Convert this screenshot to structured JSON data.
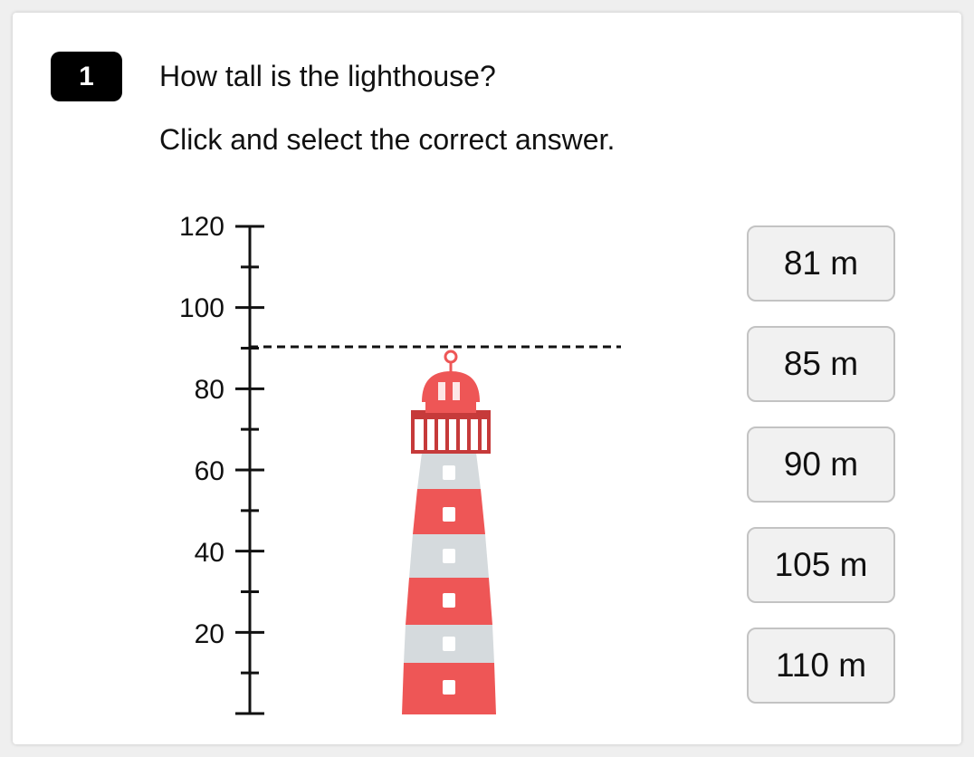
{
  "question": {
    "number": "1",
    "text": "How tall is the lighthouse?",
    "instruction": "Click and select the correct answer."
  },
  "scale": {
    "labels": [
      "120",
      "100",
      "80",
      "60",
      "40",
      "20"
    ],
    "max": 120,
    "minor_step": 10,
    "marker_value": 90
  },
  "colors": {
    "lighthouse_red": "#ee5656",
    "lighthouse_grey": "#d5dadd",
    "railing_red": "#c63a3a",
    "button_bg": "#f1f1f1",
    "button_border": "#c3c3c3"
  },
  "answers": [
    {
      "label": "81 m"
    },
    {
      "label": "85 m"
    },
    {
      "label": "90 m"
    },
    {
      "label": "105 m"
    },
    {
      "label": "110 m"
    }
  ]
}
